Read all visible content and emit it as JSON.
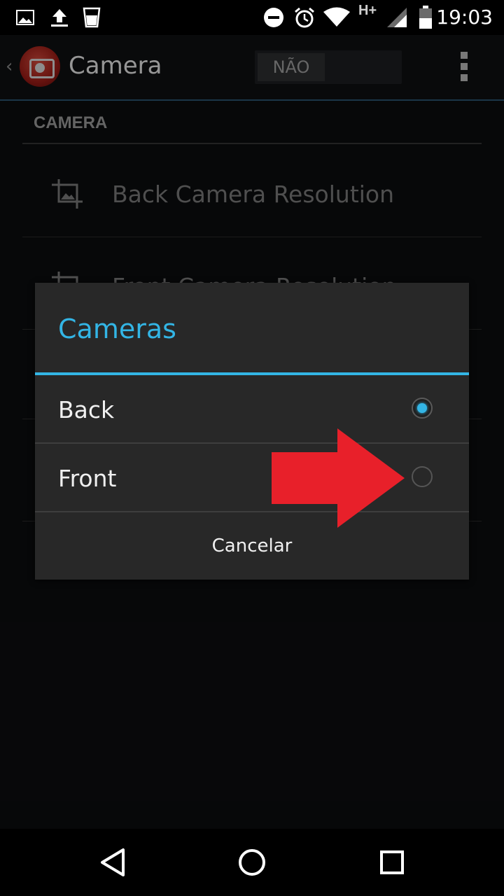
{
  "status_bar": {
    "time": "19:03",
    "network": "H+",
    "icons": [
      "image-icon",
      "upload-icon",
      "cup-icon",
      "do-not-disturb-icon",
      "alarm-icon",
      "wifi-icon",
      "signal-icon",
      "battery-icon"
    ]
  },
  "action_bar": {
    "title": "Camera",
    "toggle_label": "NÃO",
    "icons": [
      "back-chevron-icon",
      "app-logo",
      "overflow-menu-icon"
    ]
  },
  "settings": {
    "section_header": "CAMERA",
    "items": [
      {
        "label": "Back Camera Resolution",
        "icon": "crop-icon"
      },
      {
        "label": "Front Camera Resolution",
        "icon": "crop-icon"
      }
    ]
  },
  "dialog": {
    "title": "Cameras",
    "options": [
      {
        "label": "Back",
        "selected": true
      },
      {
        "label": "Front",
        "selected": false
      }
    ],
    "cancel_label": "Cancelar",
    "accent_color": "#33b5e5"
  },
  "annotation": {
    "arrow_color": "#e8202a"
  },
  "nav_bar": {
    "icons": [
      "back-triangle-icon",
      "home-circle-icon",
      "recents-square-icon"
    ]
  }
}
